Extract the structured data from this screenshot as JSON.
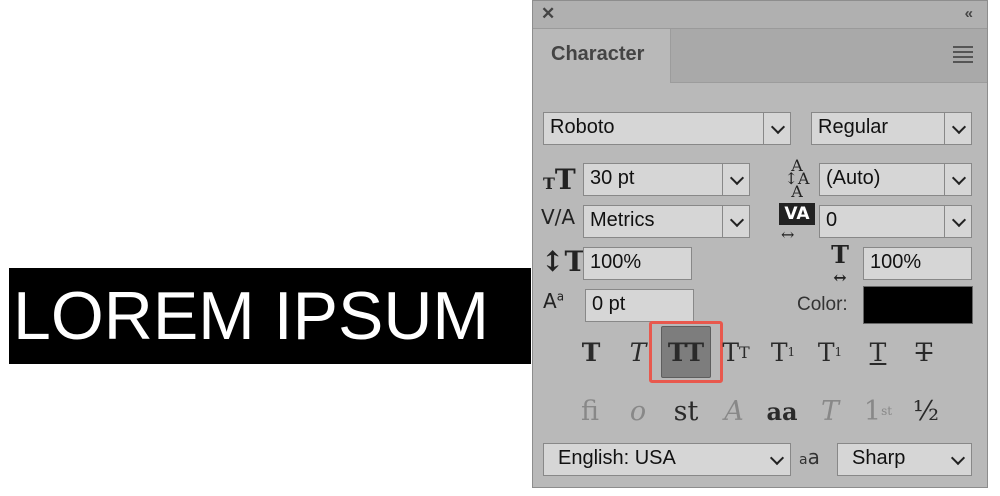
{
  "canvas": {
    "text": "LOREM IPSUM"
  },
  "panel": {
    "close_glyph": "✕",
    "collapse_glyph": "«",
    "tab_label": "Character",
    "font_family": "Roboto",
    "font_style": "Regular",
    "font_size": "30 pt",
    "leading": "(Auto)",
    "kerning": "Metrics",
    "tracking": "0",
    "vertical_scale": "100%",
    "horizontal_scale": "100%",
    "baseline_shift": "0 pt",
    "color_label": "Color:",
    "color_value": "#000000",
    "language": "English: USA",
    "antialias": "Sharp"
  },
  "icons": {
    "font_size": "font-size-icon",
    "leading": "leading-icon",
    "kerning": "kerning-icon",
    "tracking": "tracking-icon",
    "vertical_scale": "vertical-scale-icon",
    "horizontal_scale": "horizontal-scale-icon",
    "baseline_shift": "baseline-shift-icon",
    "antialias": "anti-alias-icon"
  },
  "style_buttons": [
    {
      "name": "faux-bold-button",
      "glyph": "T",
      "active": false
    },
    {
      "name": "faux-italic-button",
      "glyph": "T",
      "active": false
    },
    {
      "name": "all-caps-button",
      "glyph": "TT",
      "active": true
    },
    {
      "name": "small-caps-button",
      "glyph": "Tт",
      "active": false
    },
    {
      "name": "superscript-button",
      "glyph": "T¹",
      "active": false
    },
    {
      "name": "subscript-button",
      "glyph": "T₁",
      "active": false
    },
    {
      "name": "underline-button",
      "glyph": "T",
      "active": false
    },
    {
      "name": "strikethrough-button",
      "glyph": "T",
      "active": false
    }
  ],
  "opentype_buttons": [
    {
      "name": "standard-ligatures-button",
      "glyph": "fi"
    },
    {
      "name": "contextual-alternates-button",
      "glyph": "ơ"
    },
    {
      "name": "discretionary-ligatures-button",
      "glyph": "st"
    },
    {
      "name": "swash-button",
      "glyph": "A"
    },
    {
      "name": "stylistic-alternates-button",
      "glyph": "aa"
    },
    {
      "name": "titling-alternates-button",
      "glyph": "T"
    },
    {
      "name": "ordinals-button",
      "glyph": "1st"
    },
    {
      "name": "fractions-button",
      "glyph": "½"
    }
  ]
}
